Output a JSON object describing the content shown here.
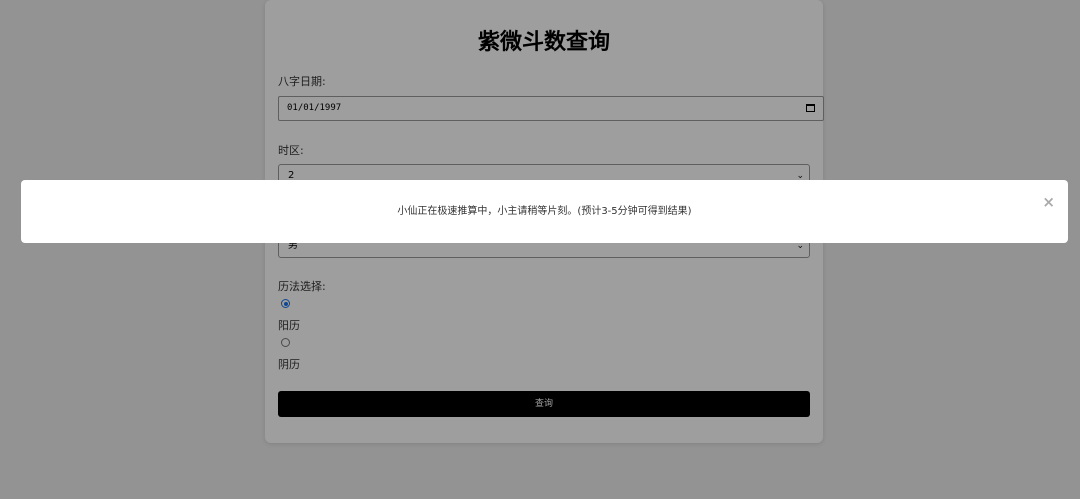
{
  "form": {
    "title": "紫微斗数查询",
    "date_label": "八字日期:",
    "date_value": "01/01/1997",
    "timezone_label": "时区:",
    "timezone_value": "2",
    "gender_value": "男",
    "calendar_label": "历法选择:",
    "calendar_options": [
      {
        "label": "阳历",
        "checked": true
      },
      {
        "label": "阴历",
        "checked": false
      }
    ],
    "submit_label": "查询"
  },
  "modal": {
    "message": "小仙正在极速推算中，小主请稍等片刻。(预计3-5分钟可得到结果)",
    "close_symbol": "×"
  },
  "icons": {
    "select_arrow": "⌄"
  },
  "colors": {
    "page_background": "#ededed",
    "button_background": "#000000",
    "radio_accent": "#1a73e8",
    "overlay": "rgba(0,0,0,0.38)"
  }
}
